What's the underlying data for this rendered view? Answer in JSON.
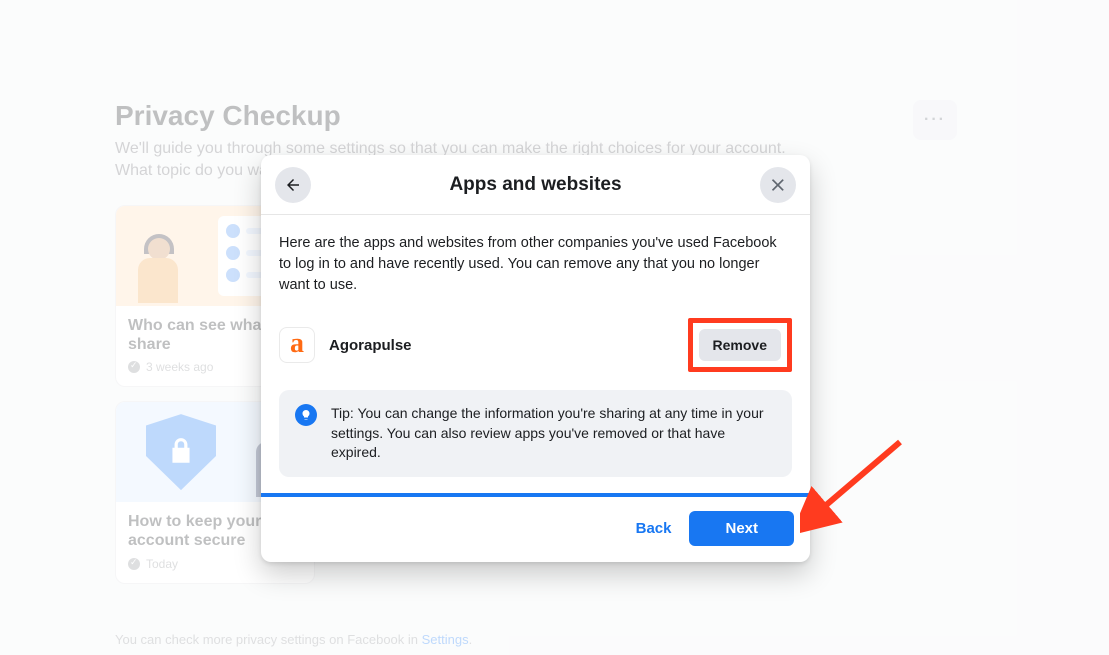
{
  "page": {
    "title": "Privacy Checkup",
    "subtitle_line1": "We'll guide you through some settings so that you can make the right choices for your account.",
    "subtitle_line2": "What topic do you want to start with?",
    "footer_prefix": "You can check more privacy settings on Facebook in ",
    "footer_link": "Settings",
    "footer_suffix": "."
  },
  "cards": [
    {
      "id": "share",
      "title": "Who can see what you share",
      "timestamp": "3 weeks ago"
    },
    {
      "id": "secure",
      "title": "How to keep your account secure",
      "timestamp": "Today"
    }
  ],
  "modal": {
    "title": "Apps and websites",
    "description": "Here are the apps and websites from other companies you've used Facebook to log in to and have recently used. You can remove any that you no longer want to use.",
    "app": {
      "name": "Agorapulse",
      "remove_label": "Remove"
    },
    "tip": "Tip: You can change the information you're sharing at any time in your settings. You can also review apps you've removed or that have expired.",
    "back_label": "Back",
    "next_label": "Next"
  },
  "icons": {
    "more": "···"
  },
  "colors": {
    "accent": "#1877f2",
    "annotation": "#ff3b1f"
  }
}
